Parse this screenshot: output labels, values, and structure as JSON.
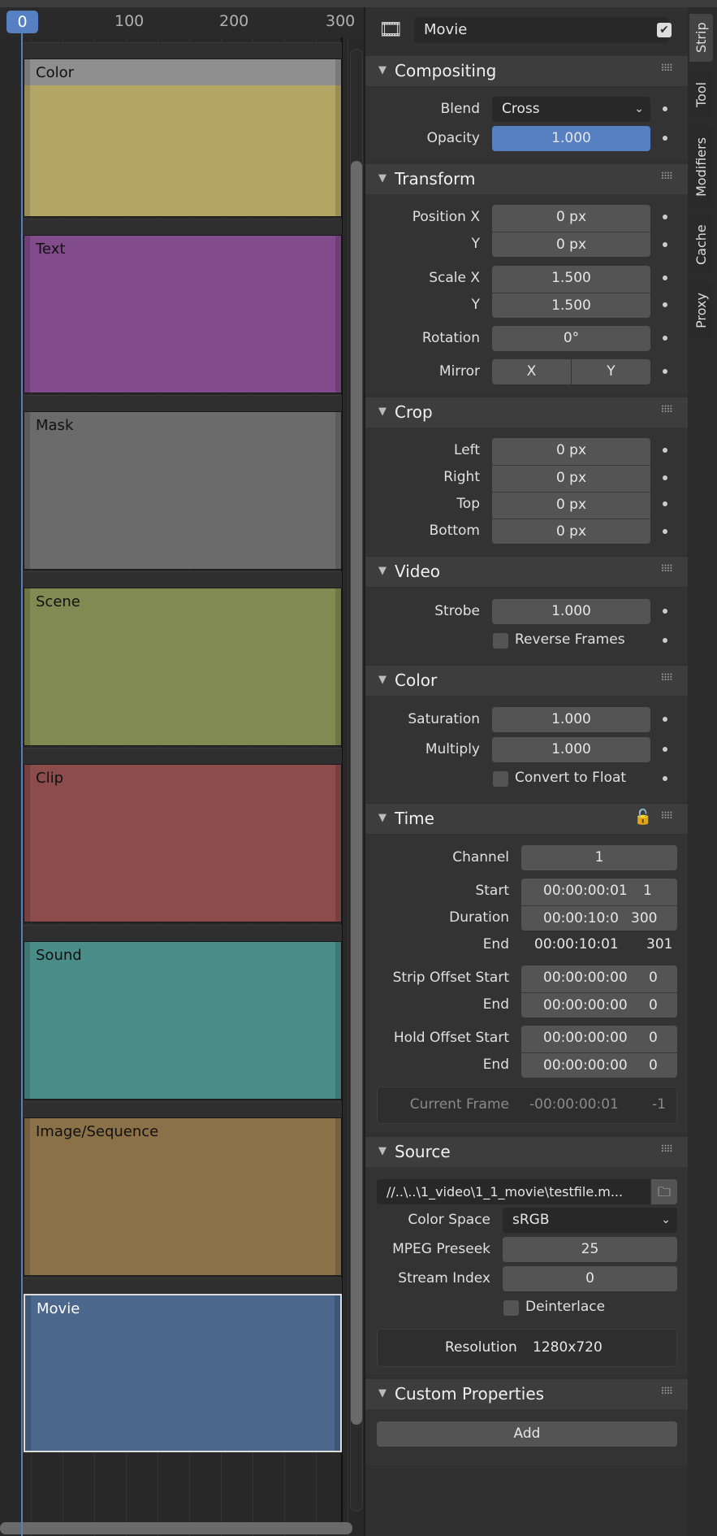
{
  "timeline": {
    "playhead": "0",
    "ticks": [
      "100",
      "200",
      "300"
    ],
    "strips": [
      {
        "name": "Color",
        "color": "#b3a665"
      },
      {
        "name": "Text",
        "color": "#824b8c"
      },
      {
        "name": "Mask",
        "color": "#6b6b6b"
      },
      {
        "name": "Scene",
        "color": "#808a52"
      },
      {
        "name": "Clip",
        "color": "#8c4c4c"
      },
      {
        "name": "Sound",
        "color": "#4a8c88"
      },
      {
        "name": "Image/Sequence",
        "color": "#8a7148"
      },
      {
        "name": "Movie",
        "color": "#4b678c"
      }
    ]
  },
  "tabs": [
    "Strip",
    "Tool",
    "Modifiers",
    "Cache",
    "Proxy"
  ],
  "strip_name": "Movie",
  "strip_enabled": true,
  "compositing": {
    "title": "Compositing",
    "blend_label": "Blend",
    "blend": "Cross",
    "opacity_label": "Opacity",
    "opacity": "1.000"
  },
  "transform": {
    "title": "Transform",
    "pos_x_label": "Position X",
    "pos_x": "0 px",
    "pos_y_label": "Y",
    "pos_y": "0 px",
    "scale_x_label": "Scale X",
    "scale_x": "1.500",
    "scale_y_label": "Y",
    "scale_y": "1.500",
    "rotation_label": "Rotation",
    "rotation": "0°",
    "mirror_label": "Mirror",
    "mirror_x": "X",
    "mirror_y": "Y"
  },
  "crop": {
    "title": "Crop",
    "left_label": "Left",
    "left": "0 px",
    "right_label": "Right",
    "right": "0 px",
    "top_label": "Top",
    "top": "0 px",
    "bottom_label": "Bottom",
    "bottom": "0 px"
  },
  "video": {
    "title": "Video",
    "strobe_label": "Strobe",
    "strobe": "1.000",
    "reverse_label": "Reverse Frames",
    "reverse": false
  },
  "color": {
    "title": "Color",
    "saturation_label": "Saturation",
    "saturation": "1.000",
    "multiply_label": "Multiply",
    "multiply": "1.000",
    "float_label": "Convert to Float",
    "float": false
  },
  "time": {
    "title": "Time",
    "channel_label": "Channel",
    "channel": "1",
    "start_label": "Start",
    "start_tc": "00:00:00:01",
    "start_f": "1",
    "duration_label": "Duration",
    "duration_tc": "00:00:10:0",
    "duration_f": "300",
    "end_label": "End",
    "end_tc": "00:00:10:01",
    "end_f": "301",
    "strip_offset_start_label": "Strip Offset Start",
    "sos_tc": "00:00:00:00",
    "sos_f": "0",
    "strip_offset_end_label": "End",
    "soe_tc": "00:00:00:00",
    "soe_f": "0",
    "hold_offset_start_label": "Hold Offset Start",
    "hos_tc": "00:00:00:00",
    "hos_f": "0",
    "hold_offset_end_label": "End",
    "hoe_tc": "00:00:00:00",
    "hoe_f": "0",
    "current_frame_label": "Current Frame",
    "current_tc": "-00:00:00:01",
    "current_f": "-1"
  },
  "source": {
    "title": "Source",
    "path": "//..\\..\\1_video\\1_1_movie\\testfile.m...",
    "colorspace_label": "Color Space",
    "colorspace": "sRGB",
    "preseek_label": "MPEG Preseek",
    "preseek": "25",
    "stream_label": "Stream Index",
    "stream": "0",
    "deinterlace_label": "Deinterlace",
    "deinterlace": false,
    "resolution_label": "Resolution",
    "resolution": "1280x720"
  },
  "custom": {
    "title": "Custom Properties",
    "add_label": "Add"
  }
}
